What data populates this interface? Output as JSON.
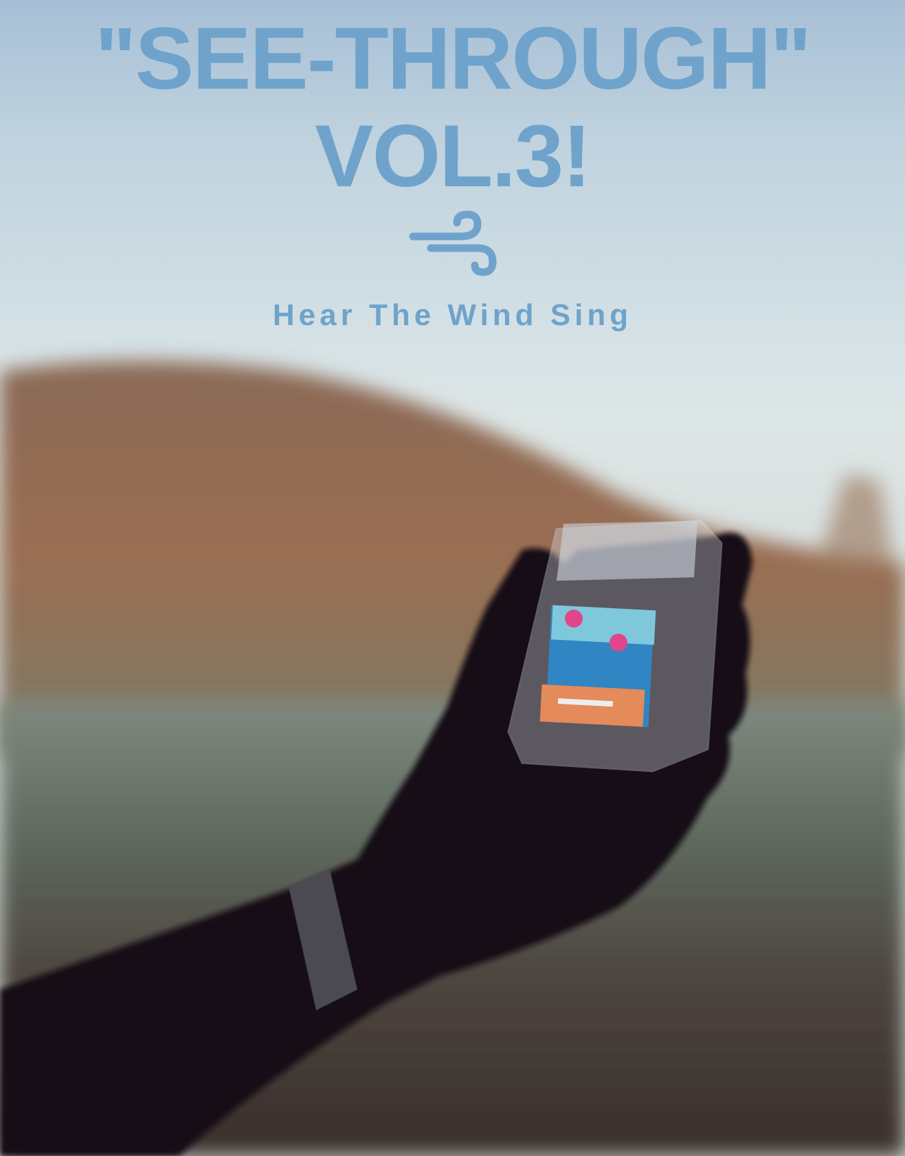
{
  "poster": {
    "title_line1": "\"SEE-THROUGH\"",
    "title_line2": "VOL.3!",
    "logo_icon": "wind-icon",
    "subtitle": "Hear The Wind Sing",
    "title_color": "#6fa3cb"
  }
}
